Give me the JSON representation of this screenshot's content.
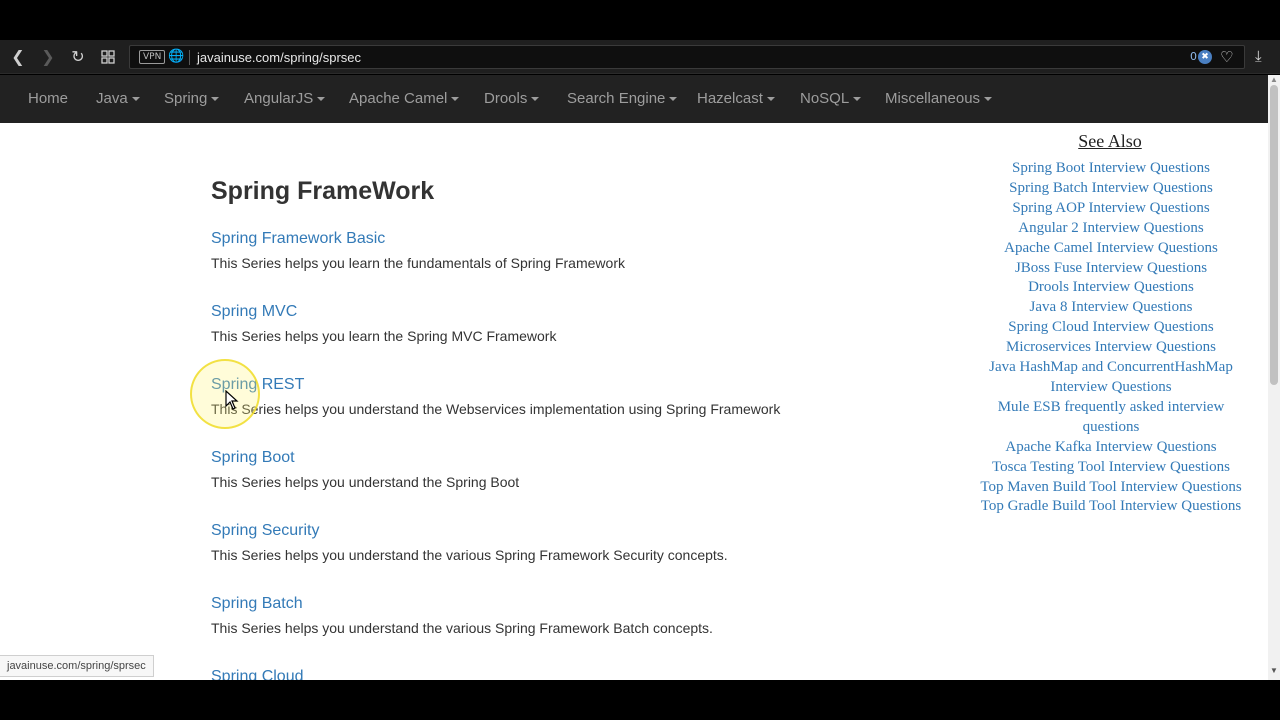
{
  "browser": {
    "url": "javainuse.com/spring/sprsec",
    "vpn_label": "VPN",
    "adblock_count": "0"
  },
  "navbar": {
    "items": [
      "Home",
      "Java",
      "Spring",
      "AngularJS",
      "Apache Camel",
      "Drools",
      "Search Engine",
      "Hazelcast",
      "NoSQL",
      "Miscellaneous"
    ]
  },
  "main": {
    "title": "Spring FrameWork",
    "series": [
      {
        "title": "Spring Framework Basic",
        "description": "This Series helps you learn the fundamentals of Spring Framework"
      },
      {
        "title": "Spring MVC",
        "description": "This Series helps you learn the Spring MVC Framework"
      },
      {
        "title": "Spring REST",
        "description": "This Series helps you understand the Webservices implementation using Spring Framework"
      },
      {
        "title": "Spring Boot",
        "description": "This Series helps you understand the Spring Boot"
      },
      {
        "title": "Spring Security",
        "description": "This Series helps you understand the various Spring Framework Security concepts."
      },
      {
        "title": "Spring Batch",
        "description": "This Series helps you understand the various Spring Framework Batch concepts."
      },
      {
        "title": "Spring Cloud",
        "description": ""
      }
    ]
  },
  "see_also": {
    "title": "See Also",
    "links": [
      "Spring Boot Interview Questions",
      "Spring Batch Interview Questions",
      "Spring AOP Interview Questions",
      "Angular 2 Interview Questions",
      "Apache Camel Interview Questions",
      "JBoss Fuse Interview Questions",
      "Drools Interview Questions",
      "Java 8 Interview Questions",
      "Spring Cloud Interview Questions",
      "Microservices Interview Questions",
      "Java HashMap and ConcurrentHashMap Interview Questions",
      "Mule ESB frequently asked interview questions",
      "Apache Kafka Interview Questions",
      "Tosca Testing Tool Interview Questions",
      "Top Maven Build Tool Interview Questions",
      "Top Gradle Build Tool Interview Questions"
    ]
  },
  "status_bar": {
    "url": "javainuse.com/spring/sprsec"
  }
}
